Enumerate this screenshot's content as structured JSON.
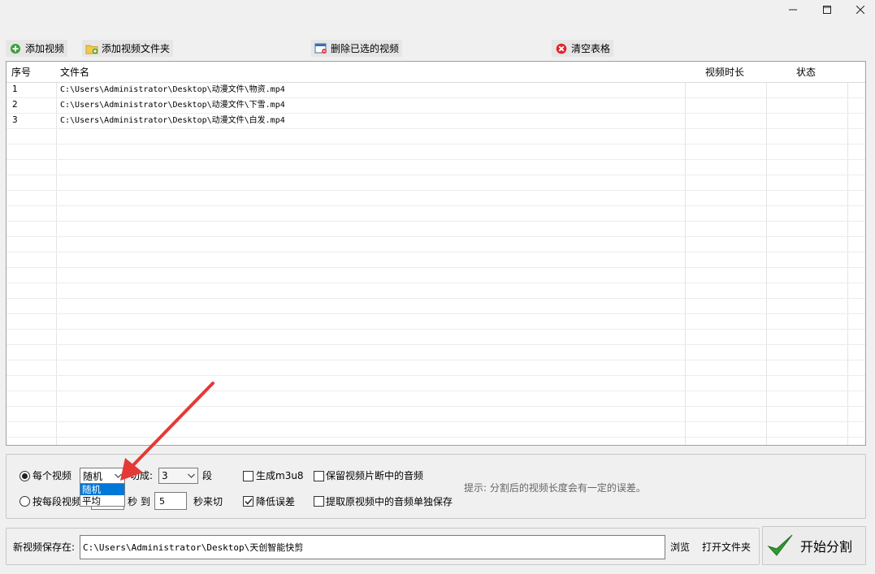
{
  "window": {
    "minimize_icon": "minimize-icon",
    "maximize_icon": "maximize-icon",
    "close_icon": "close-icon"
  },
  "toolbar": {
    "add_video": "添加视频",
    "add_folder": "添加视频文件夹",
    "delete_selected": "删除已选的视频",
    "clear_table": "清空表格"
  },
  "table": {
    "columns": [
      "序号",
      "文件名",
      "视频时长",
      "状态"
    ],
    "rows": [
      {
        "index": "1",
        "file": "C:\\Users\\Administrator\\Desktop\\动漫文件\\物资.mp4",
        "duration": "",
        "status": ""
      },
      {
        "index": "2",
        "file": "C:\\Users\\Administrator\\Desktop\\动漫文件\\下雪.mp4",
        "duration": "",
        "status": ""
      },
      {
        "index": "3",
        "file": "C:\\Users\\Administrator\\Desktop\\动漫文件\\白发.mp4",
        "duration": "",
        "status": ""
      }
    ]
  },
  "options": {
    "each_video_label": "每个视频",
    "mode_selected": "随机",
    "mode_options": [
      "随机",
      "平均"
    ],
    "cut_into_label": "切成:",
    "segments_value": "3",
    "segments_unit": "段",
    "per_segment_label": "按每段视频",
    "seconds_label": "秒",
    "to_label": "到",
    "max_seconds_value": "5",
    "seconds_cut_label": "秒来切",
    "generate_m3u8": "生成m3u8",
    "reduce_error": "降低误差",
    "keep_audio": "保留视频片断中的音频",
    "extract_audio": "提取原视频中的音频单独保存",
    "hint": "提示: 分割后的视频长度会有一定的误差。"
  },
  "save": {
    "label": "新视频保存在:",
    "path": "C:\\Users\\Administrator\\Desktop\\天创智能快剪",
    "browse": "浏览",
    "open_folder": "打开文件夹",
    "start": "开始分割"
  },
  "colors": {
    "selection": "#0078d7",
    "annotation_arrow": "#e53935",
    "start_check": "#2e9a2e"
  }
}
